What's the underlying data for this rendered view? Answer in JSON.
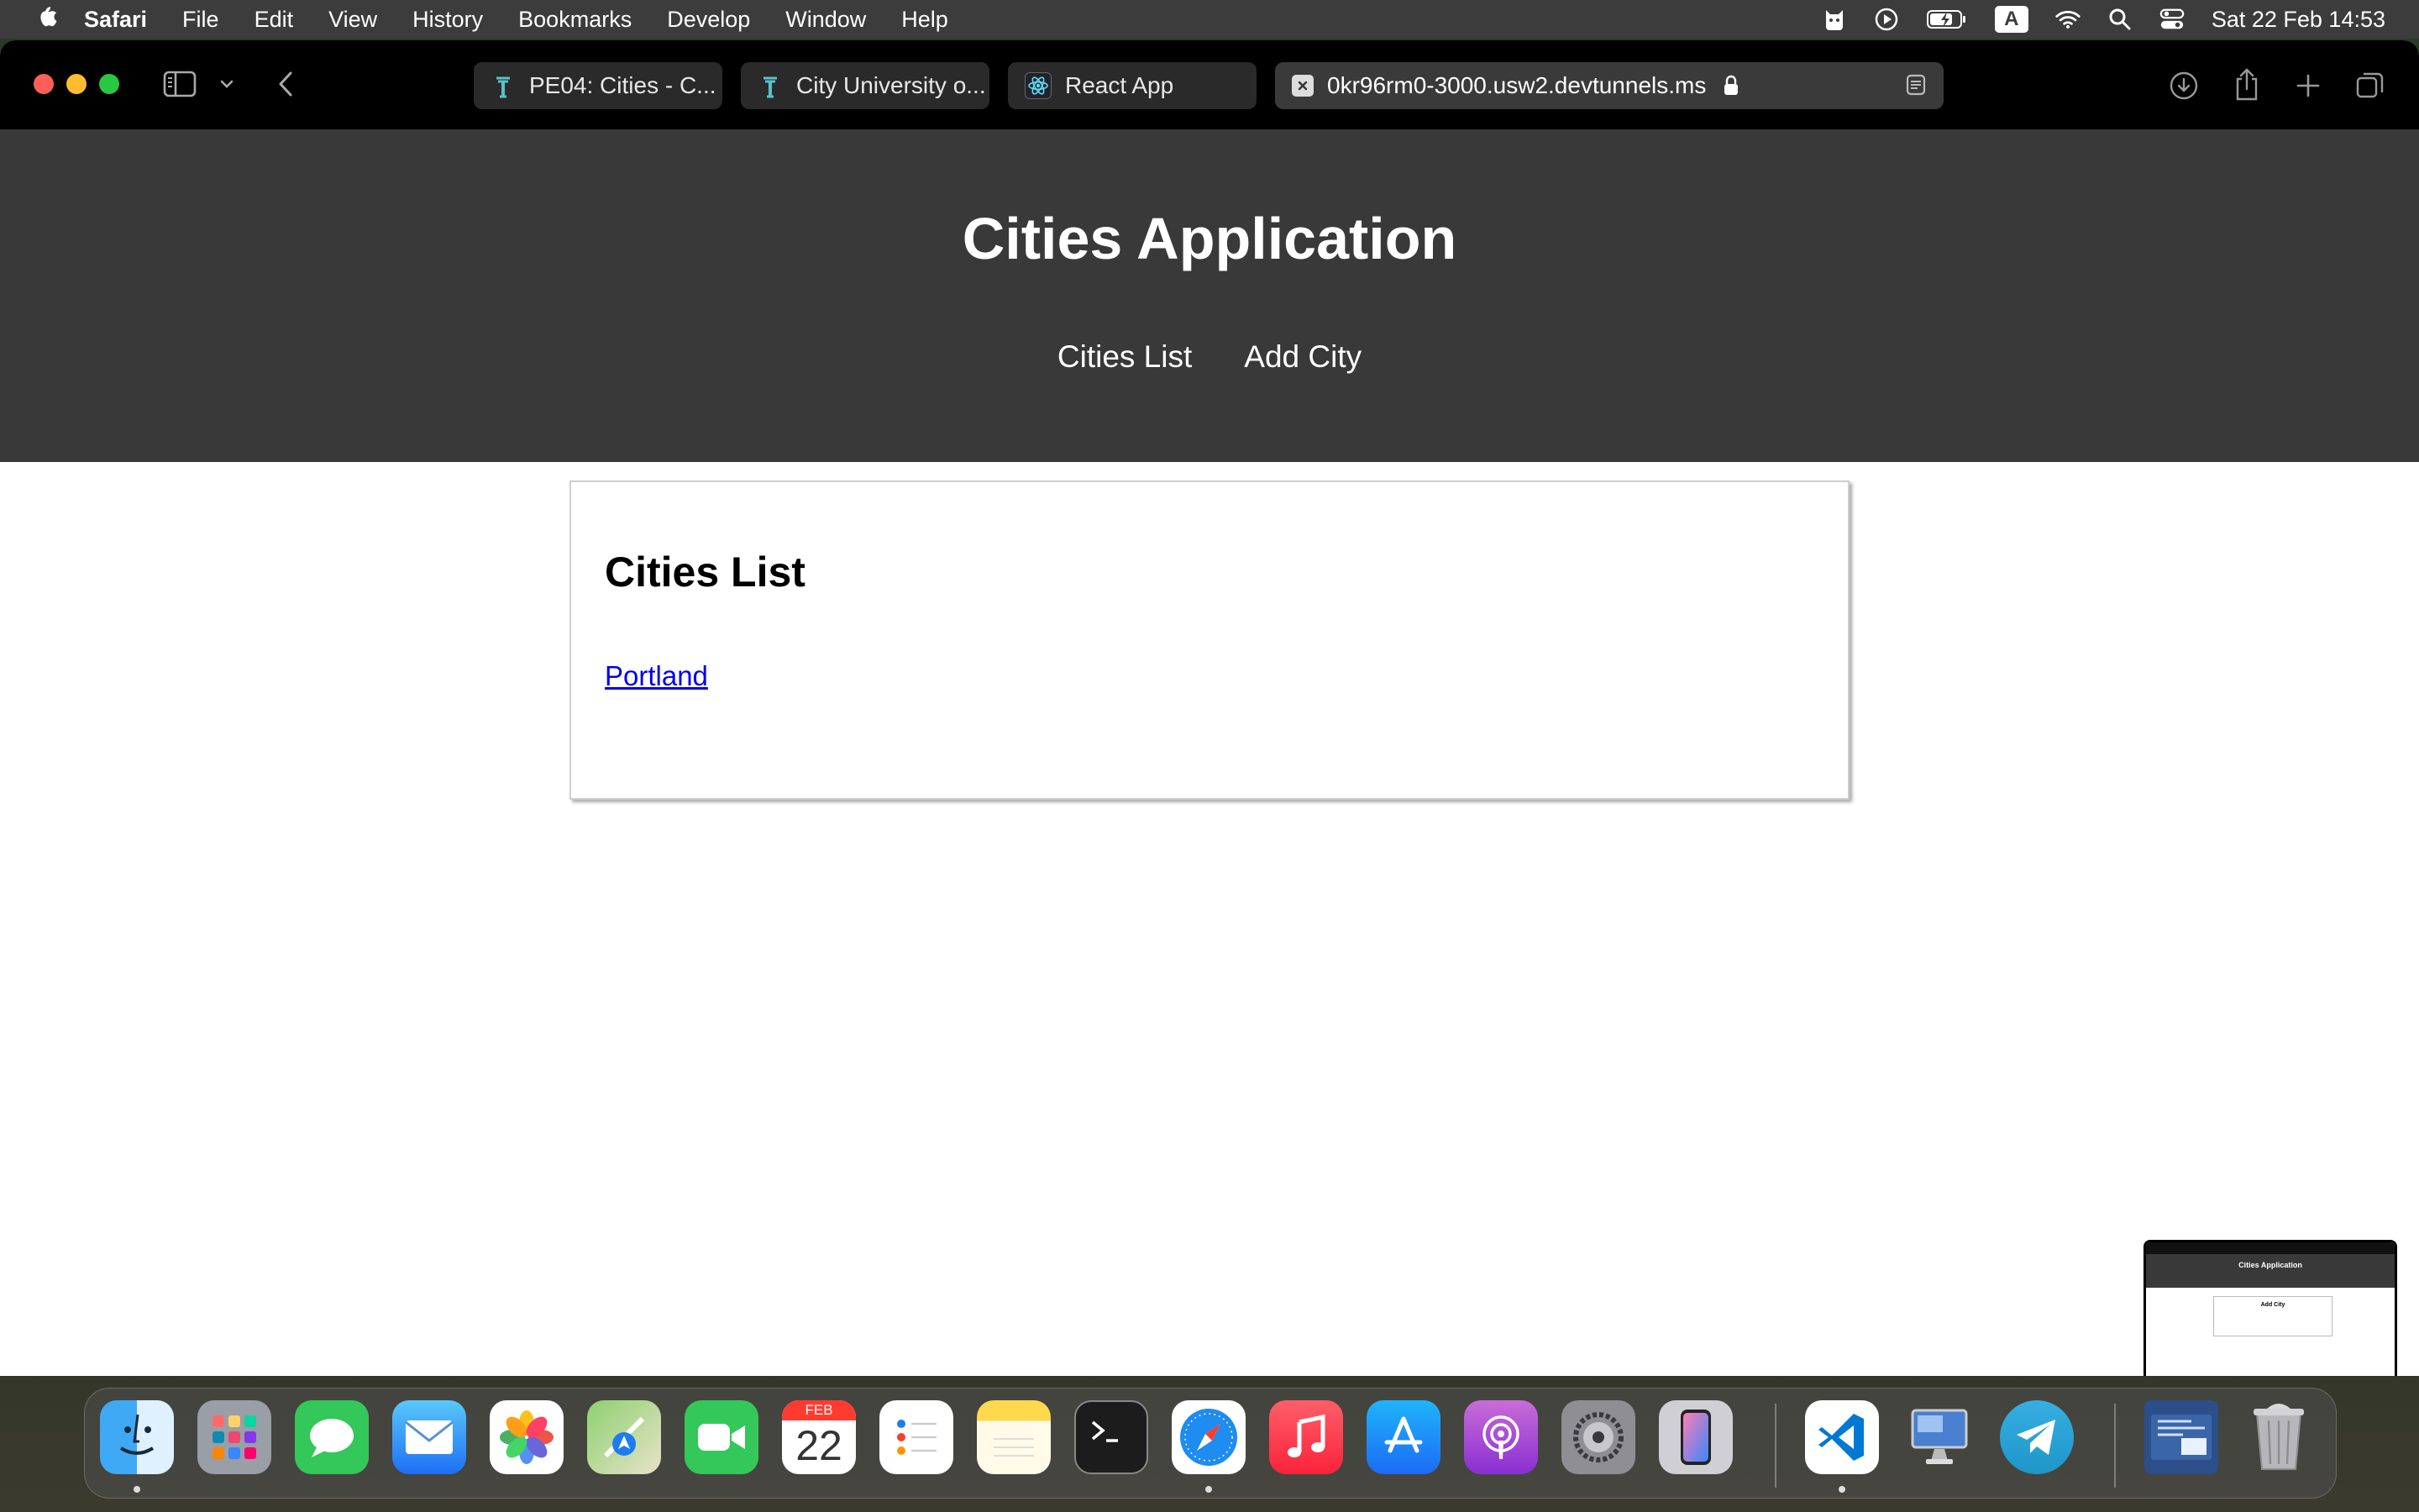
{
  "menubar": {
    "app_name": "Safari",
    "items": [
      "File",
      "Edit",
      "View",
      "History",
      "Bookmarks",
      "Develop",
      "Window",
      "Help"
    ],
    "clock": "Sat 22 Feb  14:53",
    "input_source": "A"
  },
  "browser": {
    "tabs": [
      {
        "title": "PE04: Cities - C...",
        "icon": "seattle-u-icon"
      },
      {
        "title": "City University o...",
        "icon": "seattle-u-icon"
      },
      {
        "title": "React App",
        "icon": "react-icon"
      },
      {
        "title": "0kr96rm0-3000.usw2.devtunnels.ms",
        "icon": "close-tab-icon",
        "active": true
      }
    ]
  },
  "page": {
    "header_title": "Cities Application",
    "nav": [
      "Cities List",
      "Add City"
    ],
    "card_title": "Cities List",
    "cities": [
      "Portland"
    ]
  },
  "thumbnail": {
    "title": "Cities Application",
    "card_title": "Add City"
  },
  "dock": {
    "apps": [
      "Finder",
      "Launchpad",
      "Messages",
      "Mail",
      "Photos",
      "Maps",
      "FaceTime",
      "Calendar",
      "Reminders",
      "Notes",
      "Terminal",
      "Safari",
      "Music",
      "App Store",
      "Podcasts",
      "System Settings",
      "iPhone Mirroring",
      "Visual Studio Code",
      "Remote Desktop",
      "Telegram",
      "Downloads",
      "Trash"
    ],
    "calendar_month": "FEB",
    "calendar_day": "22"
  }
}
